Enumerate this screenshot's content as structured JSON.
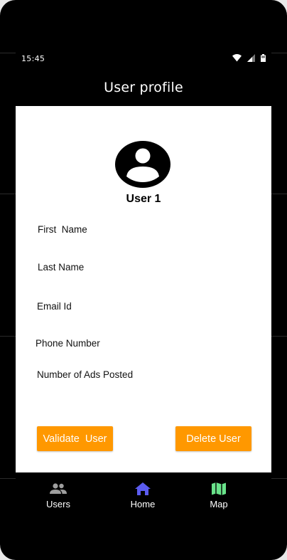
{
  "status_bar": {
    "time": "15:45",
    "icons": [
      "wifi-icon",
      "cellular-signal-icon",
      "battery-icon"
    ]
  },
  "app_bar": {
    "title": "User profile"
  },
  "profile": {
    "avatar_icon": "account-circle-icon",
    "user_name": "User 1",
    "fields": {
      "first_name": "First  Name",
      "last_name": "Last Name",
      "email": "Email Id",
      "phone": "Phone Number",
      "ads_posted": "Number of Ads Posted"
    }
  },
  "actions": {
    "validate_label": "Validate  User",
    "delete_label": "Delete User",
    "button_color": "#ff9800"
  },
  "bottom_nav": {
    "items": [
      {
        "label": "Users",
        "icon": "people-icon",
        "color": "#9e9e9e"
      },
      {
        "label": "Home",
        "icon": "home-icon",
        "color": "#5b5cf0"
      },
      {
        "label": "Map",
        "icon": "map-icon",
        "color": "#69e38a"
      }
    ]
  }
}
